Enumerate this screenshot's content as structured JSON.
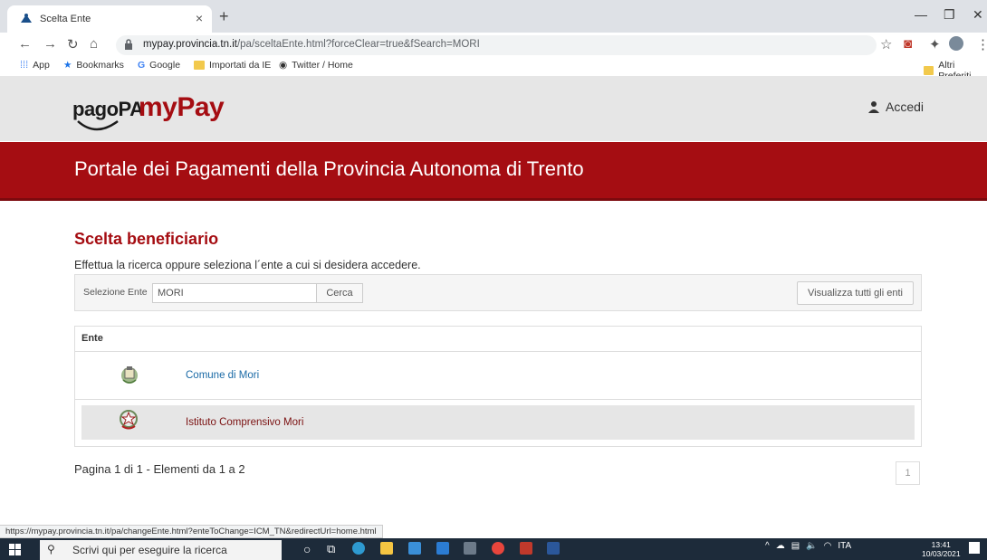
{
  "browser": {
    "tab_title": "Scelta Ente",
    "tab_close": "×",
    "new_tab": "+",
    "url_host": "mypay.provincia.tn.it",
    "url_rest": "/pa/sceltaEnte.html?forceClear=true&fSearch=MORI",
    "bookmarks": [
      "App",
      "Bookmarks",
      "Google",
      "Importati da IE",
      "Twitter / Home"
    ],
    "other_bookmarks": "Altri Preferiti",
    "status_url": "https://mypay.provincia.tn.it/pa/changeEnte.html?enteToChange=ICM_TN&redirectUrl=home.html"
  },
  "header": {
    "logo_pagopa": "pagoPA",
    "logo_mypay": "myPay",
    "login_label": "Accedi"
  },
  "banner": {
    "title": "Portale dei Pagamenti della Provincia Autonoma di Trento"
  },
  "main": {
    "section_title": "Scelta beneficiario",
    "instructions": "Effettua la ricerca oppure seleziona l´ente a cui si desidera accedere.",
    "search_label": "Selezione Ente",
    "search_value": "MORI",
    "search_button": "Cerca",
    "view_all_button": "Visualizza tutti gli enti",
    "table_header": "Ente",
    "rows": [
      {
        "name": "Comune di Mori"
      },
      {
        "name": "Istituto Comprensivo Mori"
      }
    ],
    "pagination_info": "Pagina 1 di 1 - Elementi da 1 a 2",
    "current_page": "1"
  },
  "taskbar": {
    "search_placeholder": "Scrivi qui per eseguire la ricerca",
    "language": "ITA",
    "time": "13:41",
    "date": "10/03/2021"
  },
  "colors": {
    "brand_red": "#a50d12",
    "link_blue": "#1a6aa6"
  }
}
